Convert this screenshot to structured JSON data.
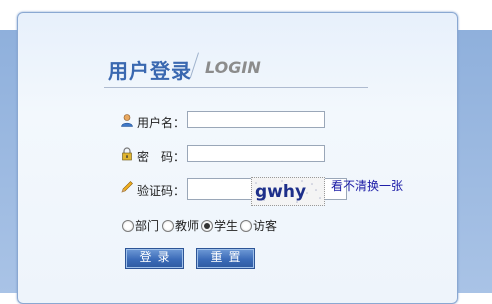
{
  "header": {
    "title_cn": "用户登录",
    "title_en": "LOGIN"
  },
  "form": {
    "username_label": "用户名：",
    "username_value": "",
    "password_label": "密　码：",
    "password_value": "",
    "captcha_label": "验证码：",
    "captcha_value": "",
    "captcha_text": "gwhy",
    "refresh_label": "看不清换一张"
  },
  "roles": [
    {
      "label": "部门",
      "checked": false
    },
    {
      "label": "教师",
      "checked": false
    },
    {
      "label": "学生",
      "checked": true
    },
    {
      "label": "访客",
      "checked": false
    }
  ],
  "buttons": {
    "login_label": "登录",
    "reset_label": "重置"
  },
  "icons": {
    "username": "user-icon",
    "password": "lock-icon",
    "captcha": "pencil-icon"
  },
  "colors": {
    "accent": "#3a68b0",
    "button": "#3b6bb8",
    "link": "#1a1aa6"
  }
}
